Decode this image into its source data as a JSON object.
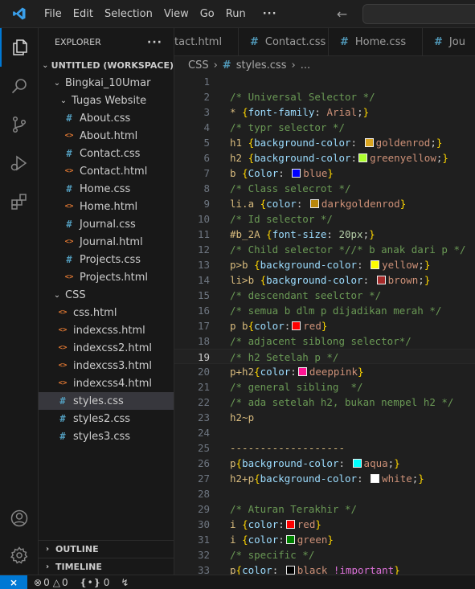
{
  "colors": {
    "accent": "#0078d4",
    "css_icon": "#519aba",
    "html_icon": "#e37933"
  },
  "menu": {
    "logo_icon": "vscode-logo-icon",
    "items": [
      "File",
      "Edit",
      "Selection",
      "View",
      "Go",
      "Run"
    ],
    "more": "···",
    "back_icon": "arrow-left-icon",
    "forward_icon": "arrow-right-icon"
  },
  "activity": [
    "explorer-icon",
    "search-icon",
    "source-control-icon",
    "run-debug-icon",
    "extensions-icon",
    "account-icon",
    "settings-gear-icon"
  ],
  "sidebar": {
    "title": "EXPLORER",
    "more": "···",
    "workspace": "UNTITLED (WORKSPACE)",
    "folder1": "Bingkai_10Umar",
    "folder2": "Tugas Website",
    "tugas_files": [
      {
        "name": "About.css",
        "type": "css"
      },
      {
        "name": "About.html",
        "type": "html"
      },
      {
        "name": "Contact.css",
        "type": "css"
      },
      {
        "name": "Contact.html",
        "type": "html"
      },
      {
        "name": "Home.css",
        "type": "css"
      },
      {
        "name": "Home.html",
        "type": "html"
      },
      {
        "name": "Journal.css",
        "type": "css"
      },
      {
        "name": "Journal.html",
        "type": "html"
      },
      {
        "name": "Projects.css",
        "type": "css"
      },
      {
        "name": "Projects.html",
        "type": "html"
      }
    ],
    "folder3": "CSS",
    "css_files": [
      {
        "name": "css.html",
        "type": "html"
      },
      {
        "name": "indexcss.html",
        "type": "html"
      },
      {
        "name": "indexcss2.html",
        "type": "html"
      },
      {
        "name": "indexcss3.html",
        "type": "html"
      },
      {
        "name": "indexcss4.html",
        "type": "html"
      },
      {
        "name": "styles.css",
        "type": "css",
        "selected": true
      },
      {
        "name": "styles2.css",
        "type": "css"
      },
      {
        "name": "styles3.css",
        "type": "css"
      }
    ],
    "outline": "OUTLINE",
    "timeline": "TIMELINE"
  },
  "tabs": [
    {
      "label": "tact.html",
      "type": "html"
    },
    {
      "label": "Contact.css",
      "type": "css"
    },
    {
      "label": "Home.css",
      "type": "css"
    },
    {
      "label": "Jou",
      "type": "css"
    }
  ],
  "breadcrumb": {
    "folder": "CSS",
    "file": "styles.css",
    "more": "..."
  },
  "editor": {
    "current_line": 19,
    "lines": [
      {
        "n": 1,
        "t": [
          [
            "",
            ""
          ]
        ]
      },
      {
        "n": 2,
        "t": [
          [
            "c",
            "/* Universal Selector */"
          ]
        ]
      },
      {
        "n": 3,
        "t": [
          [
            "s",
            "* "
          ],
          [
            "b",
            "{"
          ],
          [
            "p",
            "font-family"
          ],
          [
            "w",
            ": "
          ],
          [
            "v",
            "Arial"
          ],
          [
            "w",
            ";"
          ],
          [
            "b",
            "}"
          ]
        ]
      },
      {
        "n": 4,
        "t": [
          [
            "c",
            "/* typr selector */"
          ]
        ]
      },
      {
        "n": 5,
        "t": [
          [
            "s",
            "h1 "
          ],
          [
            "b",
            "{"
          ],
          [
            "p",
            "background-color"
          ],
          [
            "w",
            ": "
          ],
          [
            "sw",
            "#daa520"
          ],
          [
            "v",
            "goldenrod"
          ],
          [
            "w",
            ";"
          ],
          [
            "b",
            "}"
          ]
        ]
      },
      {
        "n": 6,
        "t": [
          [
            "s",
            "h2 "
          ],
          [
            "b",
            "{"
          ],
          [
            "p",
            "background-color"
          ],
          [
            "w",
            ":"
          ],
          [
            "sw",
            "#adff2f"
          ],
          [
            "v",
            "greenyellow"
          ],
          [
            "w",
            ";"
          ],
          [
            "b",
            "}"
          ]
        ]
      },
      {
        "n": 7,
        "t": [
          [
            "s",
            "b "
          ],
          [
            "b",
            "{"
          ],
          [
            "p",
            "Color"
          ],
          [
            "w",
            ": "
          ],
          [
            "sw",
            "#0000ff"
          ],
          [
            "v",
            "blue"
          ],
          [
            "b",
            "}"
          ]
        ]
      },
      {
        "n": 8,
        "t": [
          [
            "c",
            "/* Class selecrot */"
          ]
        ]
      },
      {
        "n": 9,
        "t": [
          [
            "s",
            "li.a "
          ],
          [
            "b",
            "{"
          ],
          [
            "p",
            "color"
          ],
          [
            "w",
            ": "
          ],
          [
            "sw",
            "#b8860b"
          ],
          [
            "v",
            "darkgoldenrod"
          ],
          [
            "b",
            "}"
          ]
        ]
      },
      {
        "n": 10,
        "t": [
          [
            "c",
            "/* Id selector */"
          ]
        ]
      },
      {
        "n": 11,
        "t": [
          [
            "s",
            "#b_2A "
          ],
          [
            "b",
            "{"
          ],
          [
            "p",
            "font-size"
          ],
          [
            "w",
            ": "
          ],
          [
            "n",
            "20px"
          ],
          [
            "w",
            ";"
          ],
          [
            "b",
            "}"
          ]
        ]
      },
      {
        "n": 12,
        "t": [
          [
            "c",
            "/* Child selector *//* b anak dari p */"
          ]
        ]
      },
      {
        "n": 13,
        "t": [
          [
            "s",
            "p>b "
          ],
          [
            "b",
            "{"
          ],
          [
            "p",
            "background-color"
          ],
          [
            "w",
            ": "
          ],
          [
            "sw",
            "#ffff00"
          ],
          [
            "v",
            "yellow"
          ],
          [
            "w",
            ";"
          ],
          [
            "b",
            "}"
          ]
        ]
      },
      {
        "n": 14,
        "t": [
          [
            "s",
            "li>b "
          ],
          [
            "b",
            "{"
          ],
          [
            "p",
            "background-color"
          ],
          [
            "w",
            ": "
          ],
          [
            "sw",
            "#a52a2a"
          ],
          [
            "v",
            "brown"
          ],
          [
            "w",
            ";"
          ],
          [
            "b",
            "}"
          ]
        ]
      },
      {
        "n": 15,
        "t": [
          [
            "c",
            "/* descendant seelctor */"
          ]
        ]
      },
      {
        "n": 16,
        "t": [
          [
            "c",
            "/* semua b dlm p dijadikan merah */"
          ]
        ]
      },
      {
        "n": 17,
        "t": [
          [
            "s",
            "p b"
          ],
          [
            "b",
            "{"
          ],
          [
            "p",
            "color"
          ],
          [
            "w",
            ":"
          ],
          [
            "sw",
            "#ff0000"
          ],
          [
            "v",
            "red"
          ],
          [
            "b",
            "}"
          ]
        ]
      },
      {
        "n": 18,
        "t": [
          [
            "c",
            "/* adjacent siblong selector*/"
          ]
        ]
      },
      {
        "n": 19,
        "t": [
          [
            "c",
            "/* h2 Setelah p */"
          ]
        ]
      },
      {
        "n": 20,
        "t": [
          [
            "s",
            "p+h2"
          ],
          [
            "b",
            "{"
          ],
          [
            "p",
            "color"
          ],
          [
            "w",
            ":"
          ],
          [
            "sw",
            "#ff1493"
          ],
          [
            "v",
            "deeppink"
          ],
          [
            "b",
            "}"
          ]
        ]
      },
      {
        "n": 21,
        "t": [
          [
            "c",
            "/* general sibling  */"
          ]
        ]
      },
      {
        "n": 22,
        "t": [
          [
            "c",
            "/* ada setelah h2, bukan nempel h2 */"
          ]
        ]
      },
      {
        "n": 23,
        "t": [
          [
            "s",
            "h2~p"
          ]
        ]
      },
      {
        "n": 24,
        "t": [
          [
            "",
            ""
          ]
        ]
      },
      {
        "n": 25,
        "t": [
          [
            "s",
            "-------------------"
          ]
        ]
      },
      {
        "n": 26,
        "t": [
          [
            "s",
            "p"
          ],
          [
            "b",
            "{"
          ],
          [
            "p",
            "background-color"
          ],
          [
            "w",
            ": "
          ],
          [
            "sw",
            "#00ffff"
          ],
          [
            "v",
            "aqua"
          ],
          [
            "w",
            ";"
          ],
          [
            "b",
            "}"
          ]
        ]
      },
      {
        "n": 27,
        "t": [
          [
            "s",
            "h2+p"
          ],
          [
            "b",
            "{"
          ],
          [
            "p",
            "background-color"
          ],
          [
            "w",
            ": "
          ],
          [
            "sw",
            "#ffffff"
          ],
          [
            "v",
            "white"
          ],
          [
            "w",
            ";"
          ],
          [
            "b",
            "}"
          ]
        ]
      },
      {
        "n": 28,
        "t": [
          [
            "",
            ""
          ]
        ]
      },
      {
        "n": 29,
        "t": [
          [
            "c",
            "/* Aturan Terakhir */"
          ]
        ]
      },
      {
        "n": 30,
        "t": [
          [
            "s",
            "i "
          ],
          [
            "b",
            "{"
          ],
          [
            "p",
            "color"
          ],
          [
            "w",
            ":"
          ],
          [
            "sw",
            "#ff0000"
          ],
          [
            "v",
            "red"
          ],
          [
            "b",
            "}"
          ]
        ]
      },
      {
        "n": 31,
        "t": [
          [
            "s",
            "i "
          ],
          [
            "b",
            "{"
          ],
          [
            "p",
            "color"
          ],
          [
            "w",
            ":"
          ],
          [
            "sw",
            "#008000"
          ],
          [
            "v",
            "green"
          ],
          [
            "b",
            "}"
          ]
        ]
      },
      {
        "n": 32,
        "t": [
          [
            "c",
            "/* specific */"
          ]
        ]
      },
      {
        "n": 33,
        "t": [
          [
            "s",
            "p"
          ],
          [
            "b",
            "{"
          ],
          [
            "p",
            "color"
          ],
          [
            "w",
            ": "
          ],
          [
            "sw",
            "#000000"
          ],
          [
            "v",
            "black "
          ],
          [
            "pu",
            "!important"
          ],
          [
            "b",
            "}"
          ]
        ]
      }
    ]
  },
  "status": {
    "remote_label": "⨯",
    "errors": "0",
    "warnings": "0",
    "ports": "0",
    "error_icon": "error-circle-icon",
    "warning_icon": "warning-triangle-icon",
    "ports_icon": "broadcast-icon",
    "bolt_icon": "lightning-icon"
  }
}
